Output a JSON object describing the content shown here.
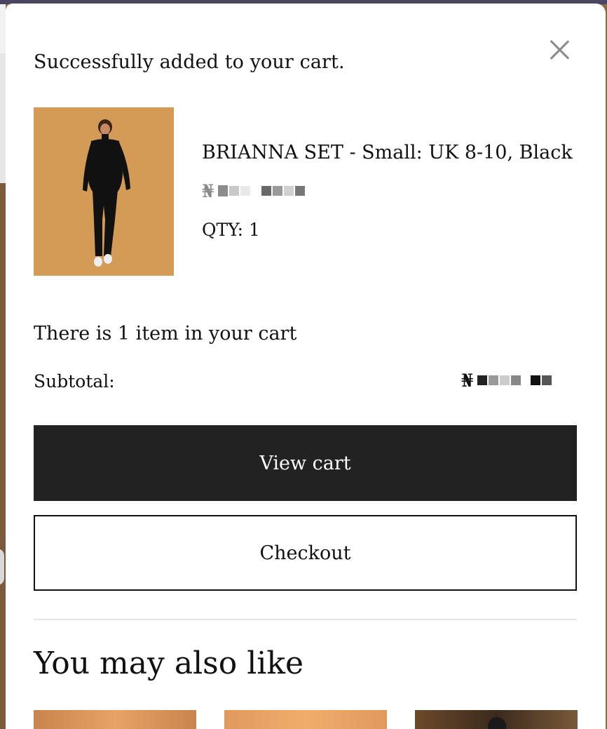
{
  "cart_popup": {
    "message": "Successfully added to your cart.",
    "item": {
      "name": "BRIANNA SET - Small: UK 8-10, Black",
      "currency_symbol": "₦",
      "qty_label": "QTY:",
      "qty_value": "1"
    },
    "cart_count_text": "There is 1 item in your cart",
    "subtotal_label": "Subtotal:",
    "subtotal_currency": "₦",
    "view_cart_label": "View cart",
    "checkout_label": "Checkout",
    "recommendations_heading": "You may also like"
  },
  "icons": {
    "close": "close-icon"
  },
  "colors": {
    "primary_button": "#222222",
    "product_background": "#d49b57"
  }
}
